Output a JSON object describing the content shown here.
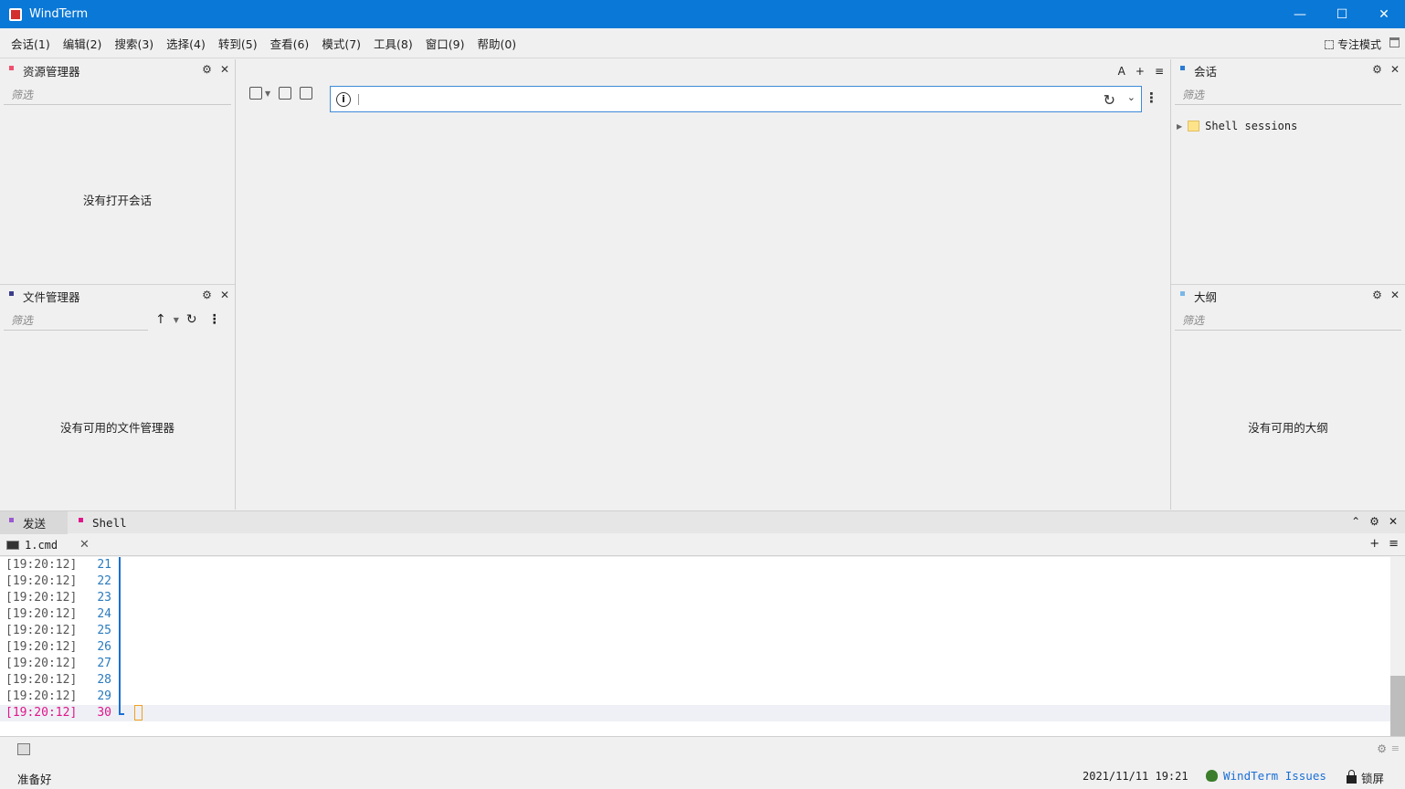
{
  "window": {
    "title": "WindTerm"
  },
  "menu": [
    "会话(1)",
    "编辑(2)",
    "搜索(3)",
    "选择(4)",
    "转到(5)",
    "查看(6)",
    "模式(7)",
    "工具(8)",
    "窗口(9)",
    "帮助(0)"
  ],
  "focus_mode": "专注模式",
  "left_top_panel": {
    "title": "资源管理器",
    "filter_placeholder": "筛选",
    "empty": "没有打开会话",
    "dot_color": "#f0506e"
  },
  "left_bottom_panel": {
    "title": "文件管理器",
    "filter_placeholder": "筛选",
    "empty": "没有可用的文件管理器",
    "dot_color": "#3c3c8c"
  },
  "right_top_panel": {
    "title": "会话",
    "filter_placeholder": "筛选",
    "tree_item": "Shell sessions",
    "dot_color": "#2a7bd4"
  },
  "right_bottom_panel": {
    "title": "大纲",
    "filter_placeholder": "筛选",
    "empty": "没有可用的大纲",
    "dot_color": "#7ab7e8"
  },
  "center_tools": [
    "A",
    "+",
    "≡"
  ],
  "address_bar": {
    "value": "",
    "placeholder": ""
  },
  "bottom_tabs": [
    {
      "label": "发送",
      "dot_color": "#9b59d0"
    },
    {
      "label": "Shell",
      "dot_color": "#e0158a"
    }
  ],
  "session_tab": {
    "label": "1.cmd"
  },
  "terminal_lines": [
    {
      "ts": "[19:20:12]",
      "ln": "21"
    },
    {
      "ts": "[19:20:12]",
      "ln": "22"
    },
    {
      "ts": "[19:20:12]",
      "ln": "23"
    },
    {
      "ts": "[19:20:12]",
      "ln": "24"
    },
    {
      "ts": "[19:20:12]",
      "ln": "25"
    },
    {
      "ts": "[19:20:12]",
      "ln": "26"
    },
    {
      "ts": "[19:20:12]",
      "ln": "27"
    },
    {
      "ts": "[19:20:12]",
      "ln": "28"
    },
    {
      "ts": "[19:20:12]",
      "ln": "29"
    },
    {
      "ts": "[19:20:12]",
      "ln": "30"
    }
  ],
  "status": {
    "text": "准备好",
    "datetime": "2021/11/11 19:21",
    "issues_link": "WindTerm Issues",
    "lock_label": "锁屏"
  }
}
